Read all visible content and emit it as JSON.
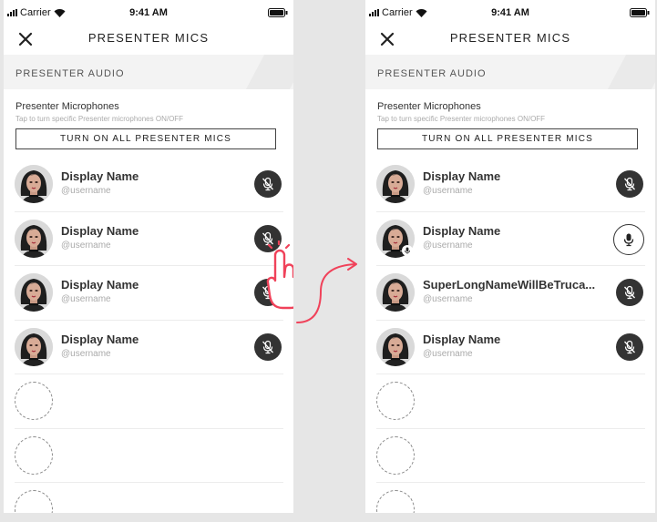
{
  "status_bar": {
    "carrier": "Carrier",
    "time": "9:41 AM"
  },
  "nav": {
    "title": "PRESENTER MICS"
  },
  "section": {
    "header": "PRESENTER AUDIO",
    "subtitle": "Presenter Microphones",
    "hint": "Tap to turn specific Presenter microphones ON/OFF",
    "all_button": "TURN ON ALL PRESENTER MICS"
  },
  "before": {
    "presenters": [
      {
        "name": "Display Name",
        "handle": "@username",
        "mic": "off"
      },
      {
        "name": "Display Name",
        "handle": "@username",
        "mic": "off"
      },
      {
        "name": "Display Name",
        "handle": "@username",
        "mic": "off"
      },
      {
        "name": "Display Name",
        "handle": "@username",
        "mic": "off"
      }
    ],
    "empty_slots": 3
  },
  "after": {
    "presenters": [
      {
        "name": "Display Name",
        "handle": "@username",
        "mic": "off"
      },
      {
        "name": "Display Name",
        "handle": "@username",
        "mic": "on"
      },
      {
        "name": "SuperLongNameWillBeTruca...",
        "handle": "@username",
        "mic": "off"
      },
      {
        "name": "Display Name",
        "handle": "@username",
        "mic": "off"
      }
    ],
    "empty_slots": 3
  },
  "colors": {
    "accent": "#f0425a",
    "mic_off_bg": "#333333",
    "background": "#e6e6e6"
  }
}
